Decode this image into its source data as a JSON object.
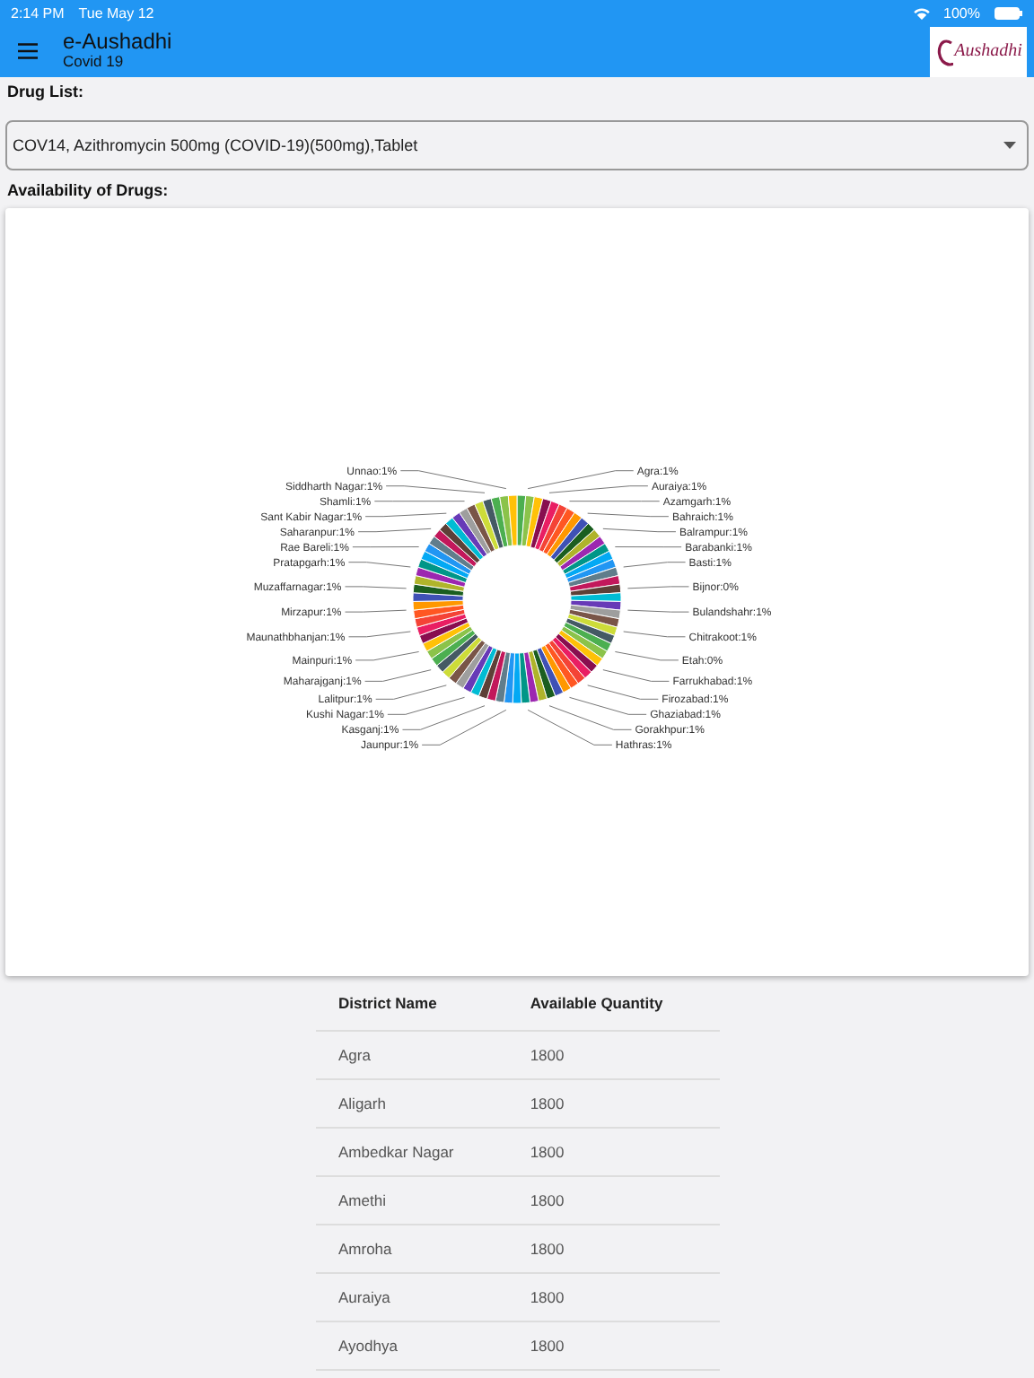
{
  "status_bar": {
    "time": "2:14 PM",
    "date": "Tue May 12",
    "battery": "100%"
  },
  "app_bar": {
    "title": "e-Aushadhi",
    "subtitle": "Covid 19",
    "logo_text": "Aushadhi"
  },
  "drug_list": {
    "label": "Drug List:",
    "value": "COV14, Azithromycin 500mg (COVID-19)(500mg),Tablet"
  },
  "availability": {
    "label": "Availability of Drugs:",
    "left_labels": [
      "Unnao:1%",
      "Siddharth Nagar:1%",
      "Shamli:1%",
      "Sant Kabir Nagar:1%",
      "Saharanpur:1%",
      "Rae Bareli:1%",
      "Pratapgarh:1%",
      "Muzaffarnagar:1%",
      "Mirzapur:1%",
      "Maunathbhanjan:1%",
      "Mainpuri:1%",
      "Maharajganj:1%",
      "Lalitpur:1%",
      "Kushi Nagar:1%",
      "Kasganj:1%",
      "Jaunpur:1%"
    ],
    "right_labels": [
      "Agra:1%",
      "Auraiya:1%",
      "Azamgarh:1%",
      "Bahraich:1%",
      "Balrampur:1%",
      "Barabanki:1%",
      "Basti:1%",
      "Bijnor:0%",
      "Bulandshahr:1%",
      "Chitrakoot:1%",
      "Etah:0%",
      "Farrukhabad:1%",
      "Firozabad:1%",
      "Ghaziabad:1%",
      "Gorakhpur:1%",
      "Hathras:1%"
    ]
  },
  "table": {
    "columns": [
      "District Name",
      "Available Quantity"
    ],
    "rows": [
      [
        "Agra",
        "1800"
      ],
      [
        "Aligarh",
        "1800"
      ],
      [
        "Ambedkar Nagar",
        "1800"
      ],
      [
        "Amethi",
        "1800"
      ],
      [
        "Amroha",
        "1800"
      ],
      [
        "Auraiya",
        "1800"
      ],
      [
        "Ayodhya",
        "1800"
      ]
    ]
  }
}
